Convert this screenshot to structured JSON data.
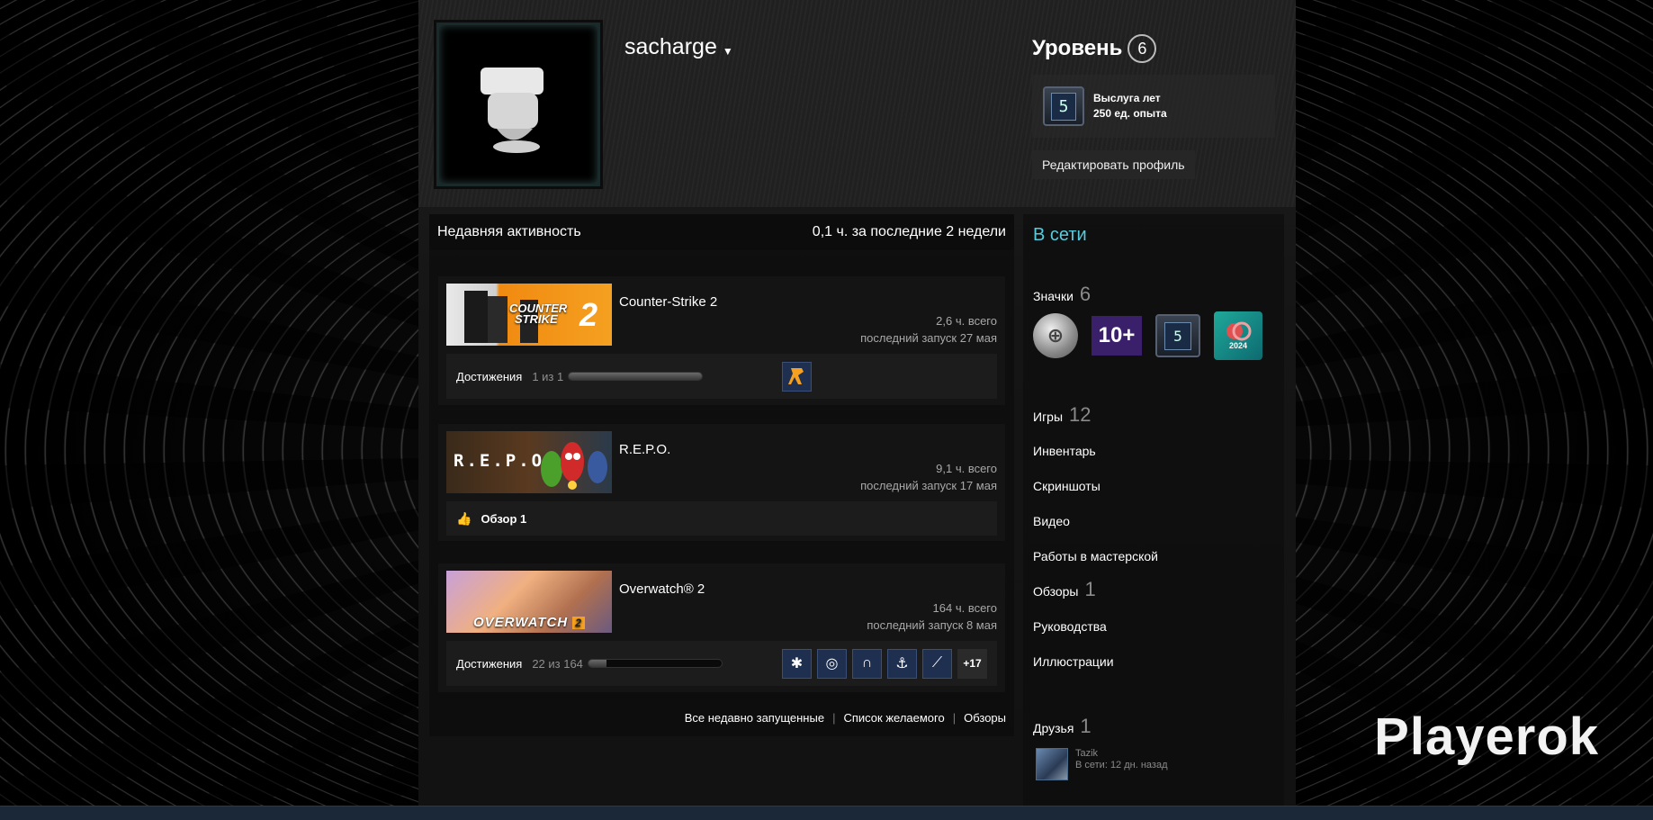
{
  "header": {
    "persona_name": "sacharge",
    "level_label": "Уровень",
    "level_value": "6",
    "favorite_badge": {
      "icon_value": "5",
      "title": "Выслуга лет",
      "xp": "250 ед. опыта"
    },
    "edit_profile_label": "Редактировать профиль"
  },
  "activity": {
    "title": "Недавняя активность",
    "summary": "0,1 ч. за последние 2 недели",
    "games": [
      {
        "name": "Counter-Strike 2",
        "total": "2,6 ч. всего",
        "last_played": "последний запуск 27 мая",
        "capsule_text_1": "COUNTER",
        "capsule_text_2": "STRIKE",
        "capsule_text_3": "2",
        "footer_label": "Достижения",
        "footer_count": "1 из 1",
        "progress": 1.0
      },
      {
        "name": "R.E.P.O.",
        "total": "9,1 ч. всего",
        "last_played": "последний запуск 17 мая",
        "capsule_text_1": "R.E.P.O.",
        "footer_label": "Обзор 1"
      },
      {
        "name": "Overwatch® 2",
        "total": "164 ч. всего",
        "last_played": "последний запуск 8 мая",
        "capsule_text_1": "OVERWATCH",
        "capsule_text_2": "2",
        "footer_label": "Достижения",
        "footer_count": "22 из 164",
        "progress": 0.134,
        "more_achievements": "+17"
      }
    ],
    "links": {
      "recent": "Все недавно запущенные",
      "wishlist": "Список желаемого",
      "reviews": "Обзоры"
    }
  },
  "sidebar": {
    "status": "В сети",
    "badges_label": "Значки",
    "badges_count": "6",
    "badge_10_text": "10+",
    "badge_5_text": "5",
    "badge_steam_year": "2024",
    "games_label": "Игры",
    "games_count": "12",
    "inventory": "Инвентарь",
    "screenshots": "Скриншоты",
    "videos": "Видео",
    "workshop": "Работы в мастерской",
    "reviews_label": "Обзоры",
    "reviews_count": "1",
    "guides": "Руководства",
    "artwork": "Иллюстрации",
    "friends_label": "Друзья",
    "friends_count": "1",
    "friend": {
      "name": "Tazik",
      "status": "В сети: 12 дн. назад"
    }
  },
  "watermark": "Playerok",
  "colors": {
    "online": "#57cbde",
    "footer_bar": "#1b2838"
  }
}
